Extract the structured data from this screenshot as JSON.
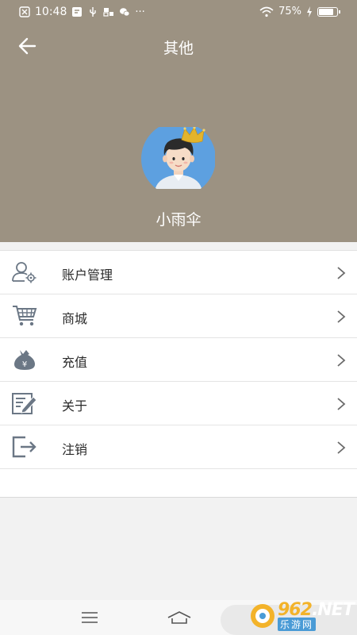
{
  "status_bar": {
    "time": "10:48",
    "battery_percent": "75%",
    "more": "···"
  },
  "header": {
    "title": "其他",
    "back_icon": "arrow-left-icon"
  },
  "profile": {
    "username": "小雨伞",
    "avatar_icon": "avatar-crown-icon"
  },
  "menu": {
    "items": [
      {
        "label": "账户管理",
        "icon": "user-settings-icon"
      },
      {
        "label": "商城",
        "icon": "cart-icon"
      },
      {
        "label": "充值",
        "icon": "money-bag-icon"
      },
      {
        "label": "关于",
        "icon": "edit-note-icon"
      },
      {
        "label": "注销",
        "icon": "logout-icon"
      }
    ]
  },
  "watermark": {
    "number": "962",
    "suffix": ".NET",
    "sub": "乐游网"
  },
  "colors": {
    "header_bg": "#9c9282",
    "icon_color": "#6b7785",
    "crown": "#e3b42c",
    "avatar_bg": "#5da0e0"
  }
}
